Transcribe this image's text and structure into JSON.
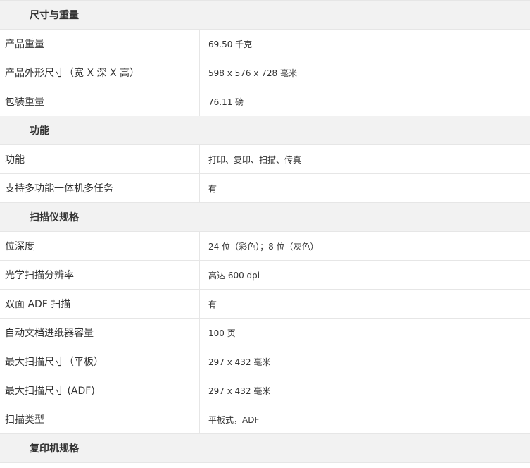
{
  "sections": [
    {
      "title": "尺寸与重量",
      "rows": [
        {
          "label": "产品重量",
          "value": "69.50 千克"
        },
        {
          "label": "产品外形尺寸（宽 X 深 X 高）",
          "value": "598 x 576 x 728 毫米"
        },
        {
          "label": "包装重量",
          "value": "76.11 磅"
        }
      ]
    },
    {
      "title": "功能",
      "rows": [
        {
          "label": "功能",
          "value": "打印、复印、扫描、传真"
        },
        {
          "label": "支持多功能一体机多任务",
          "value": "有"
        }
      ]
    },
    {
      "title": "扫描仪规格",
      "rows": [
        {
          "label": "位深度",
          "value": "24 位（彩色）；8 位（灰色）"
        },
        {
          "label": "光学扫描分辨率",
          "value": "高达 600 dpi"
        },
        {
          "label": "双面 ADF 扫描",
          "value": "有"
        },
        {
          "label": "自动文档进纸器容量",
          "value": "100 页"
        },
        {
          "label": "最大扫描尺寸（平板）",
          "value": "297 x 432 毫米"
        },
        {
          "label": "最大扫描尺寸 (ADF)",
          "value": "297 x 432 毫米"
        },
        {
          "label": "扫描类型",
          "value": "平板式，ADF"
        }
      ]
    },
    {
      "title": "复印机规格",
      "rows": []
    }
  ]
}
